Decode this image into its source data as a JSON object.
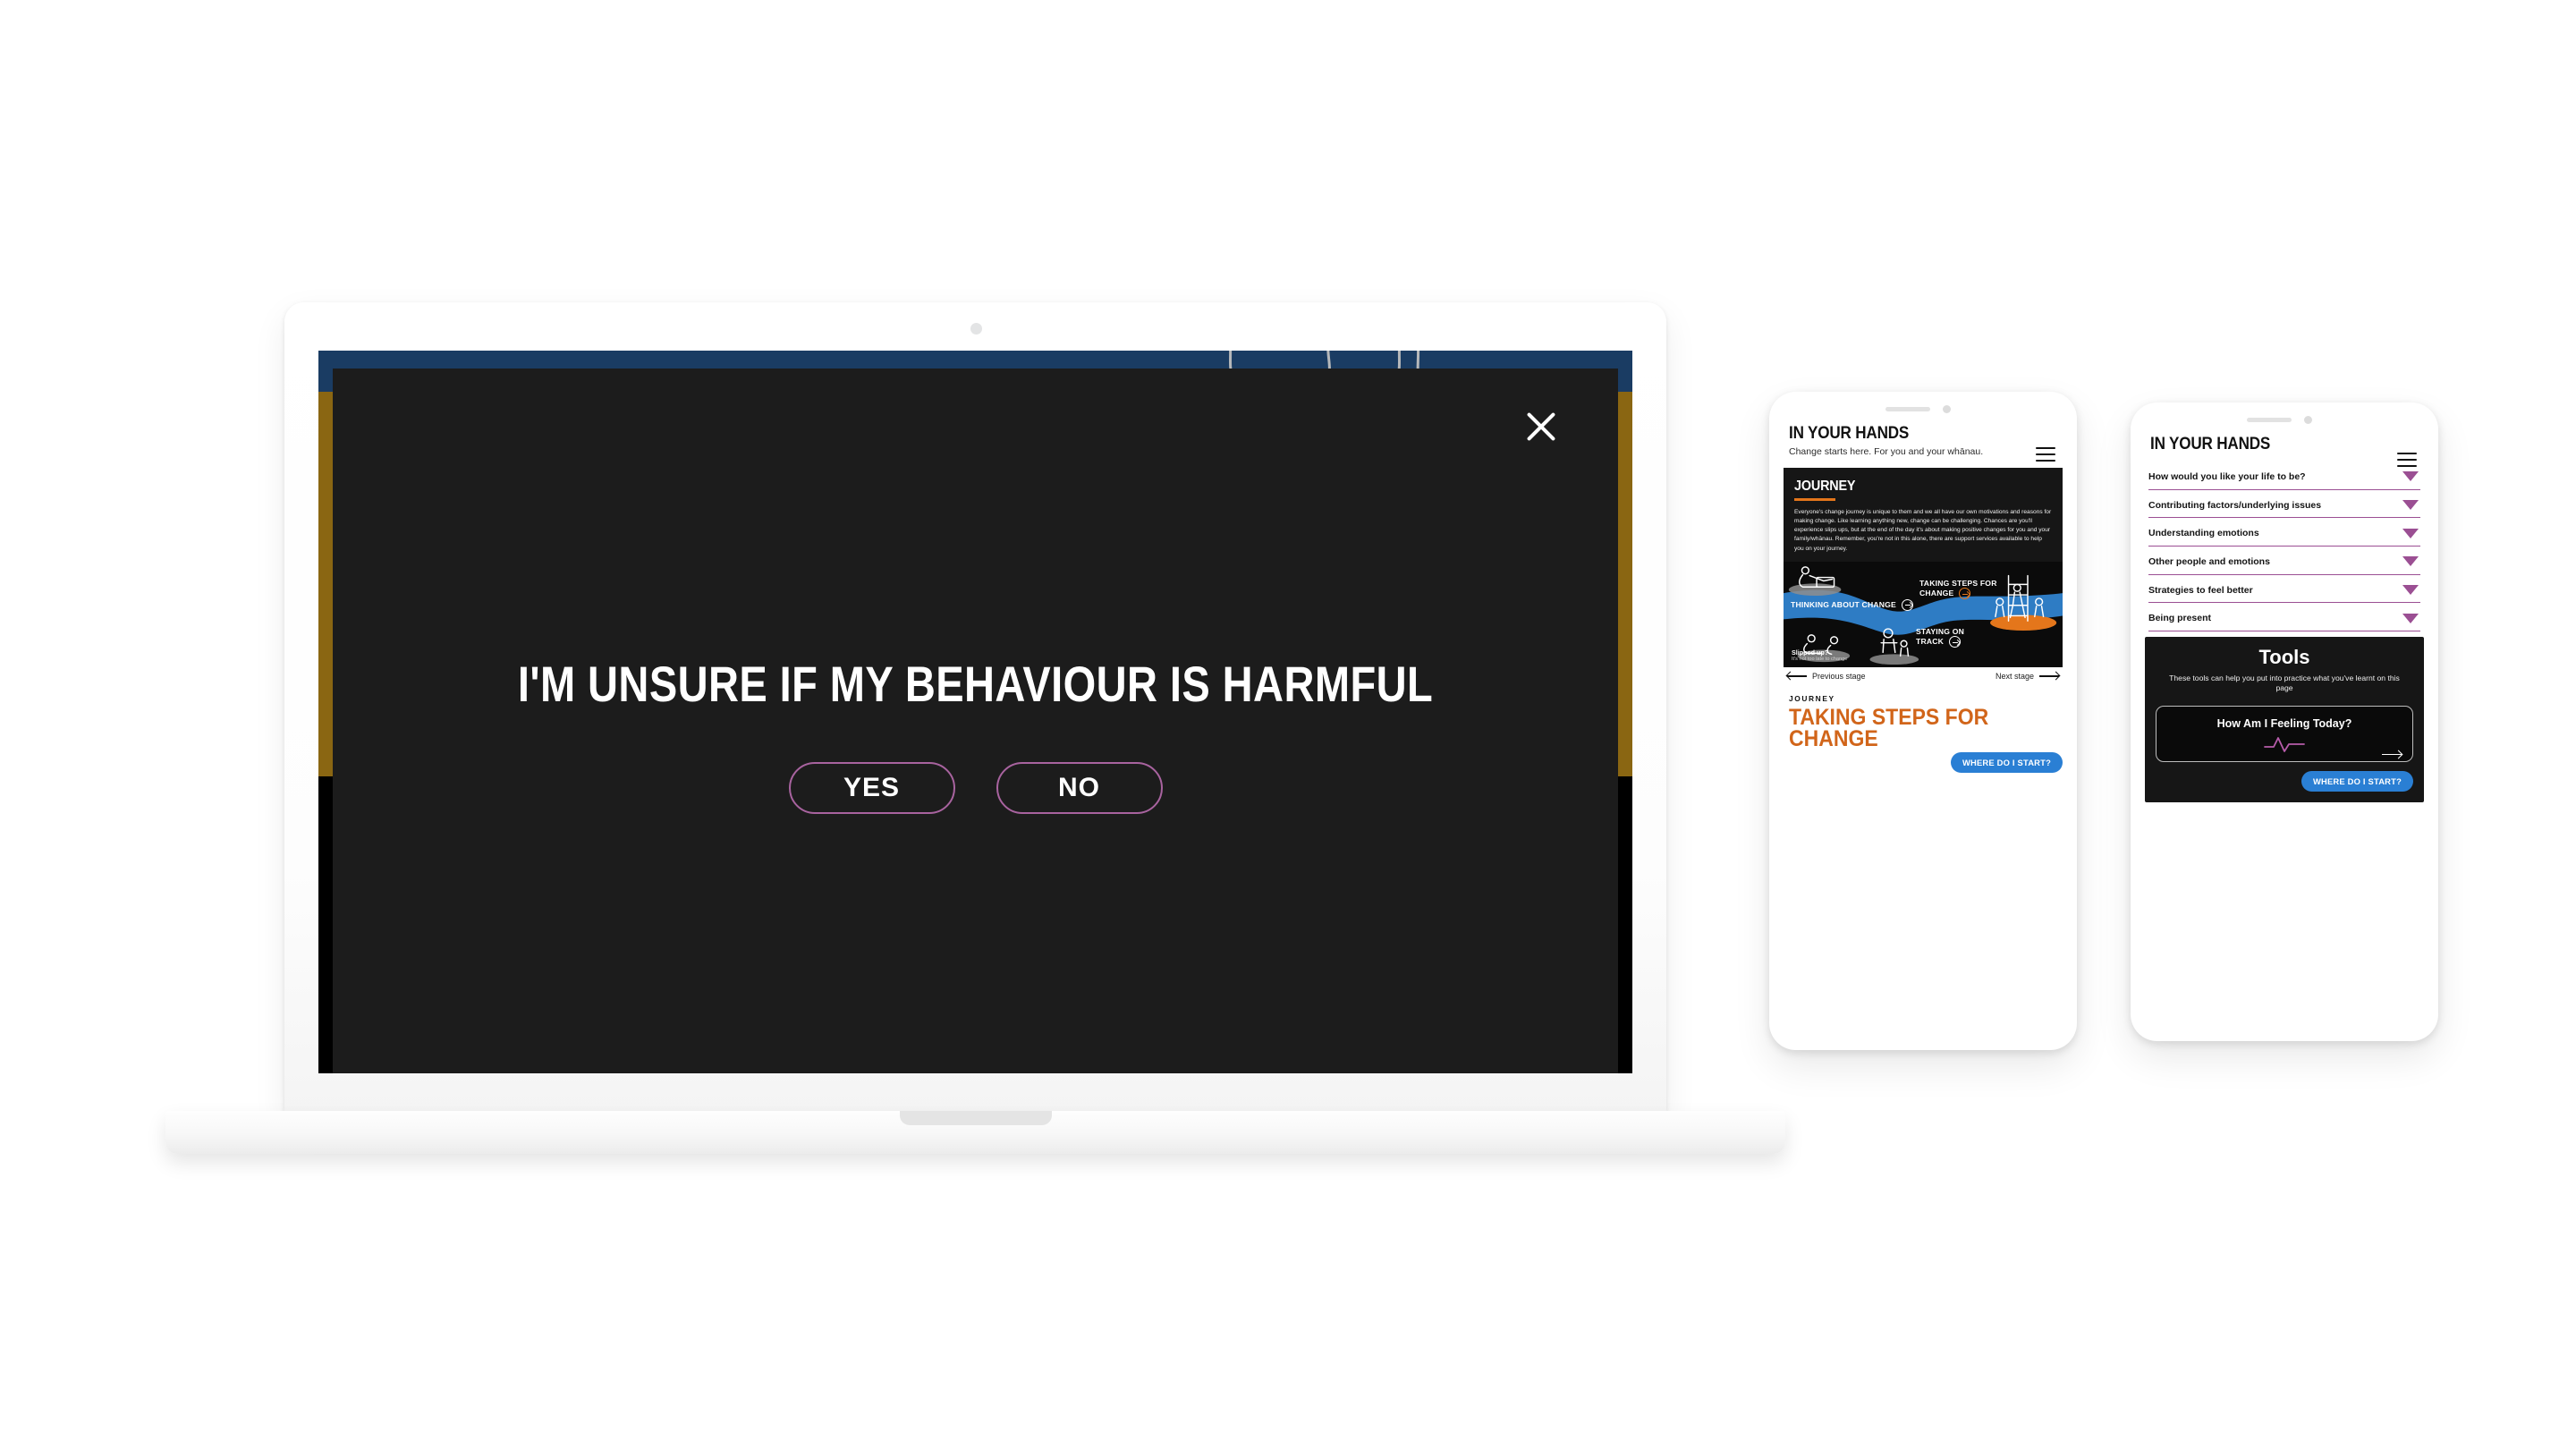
{
  "brand": {
    "accent_purple": "#9b4f93",
    "accent_orange": "#d1651a",
    "accent_blue": "#2a7fd4",
    "navy": "#1a3c63",
    "gold": "#8a6612",
    "dark": "#1c1c1c"
  },
  "laptop": {
    "modal": {
      "headline": "I'M UNSURE IF MY BEHAVIOUR IS HARMFUL",
      "yes_label": "YES",
      "no_label": "NO",
      "close_icon": "close-icon"
    }
  },
  "phone_1": {
    "header": {
      "logo": "IN YOUR HANDS",
      "tagline": "Change starts here. For you and your whānau.",
      "menu_icon": "hamburger-menu-icon"
    },
    "journey_card": {
      "title": "JOURNEY",
      "body": "Everyone's change journey is unique to them and we all have our own motivations and reasons for making change. Like learning anything new, change can be challenging. Chances are you'll experience slips ups, but at the end of the day it's about making positive changes for you and your family/whānau. Remember, you're not in this alone, there are support services available to help you on your journey."
    },
    "map": {
      "stage_1": "THINKING ABOUT CHANGE",
      "stage_2": "TAKING STEPS FOR CHANGE",
      "stage_3": "STAYING ON TRACK",
      "slip_title": "Slipped up?",
      "slip_sub": "It's not too late to change"
    },
    "nav": {
      "previous": "Previous stage",
      "next": "Next stage"
    },
    "footer": {
      "eyebrow": "JOURNEY",
      "title": "TAKING STEPS FOR CHANGE",
      "cta": "WHERE DO I START?"
    }
  },
  "phone_2": {
    "header": {
      "logo": "IN YOUR HANDS",
      "menu_icon": "hamburger-menu-icon"
    },
    "accordion": [
      {
        "label": "How would you like your life to be?"
      },
      {
        "label": "Contributing factors/underlying issues"
      },
      {
        "label": "Understanding emotions"
      },
      {
        "label": "Other people and emotions"
      },
      {
        "label": "Strategies to feel better"
      },
      {
        "label": "Being present"
      }
    ],
    "tools": {
      "heading": "Tools",
      "subtitle": "These tools can help you put into practice what you've learnt on this page",
      "card_title": "How Am I Feeling Today?",
      "card_icon": "pulse-icon",
      "card_arrow_icon": "arrow-right-icon",
      "cta": "WHERE DO I START?"
    }
  }
}
